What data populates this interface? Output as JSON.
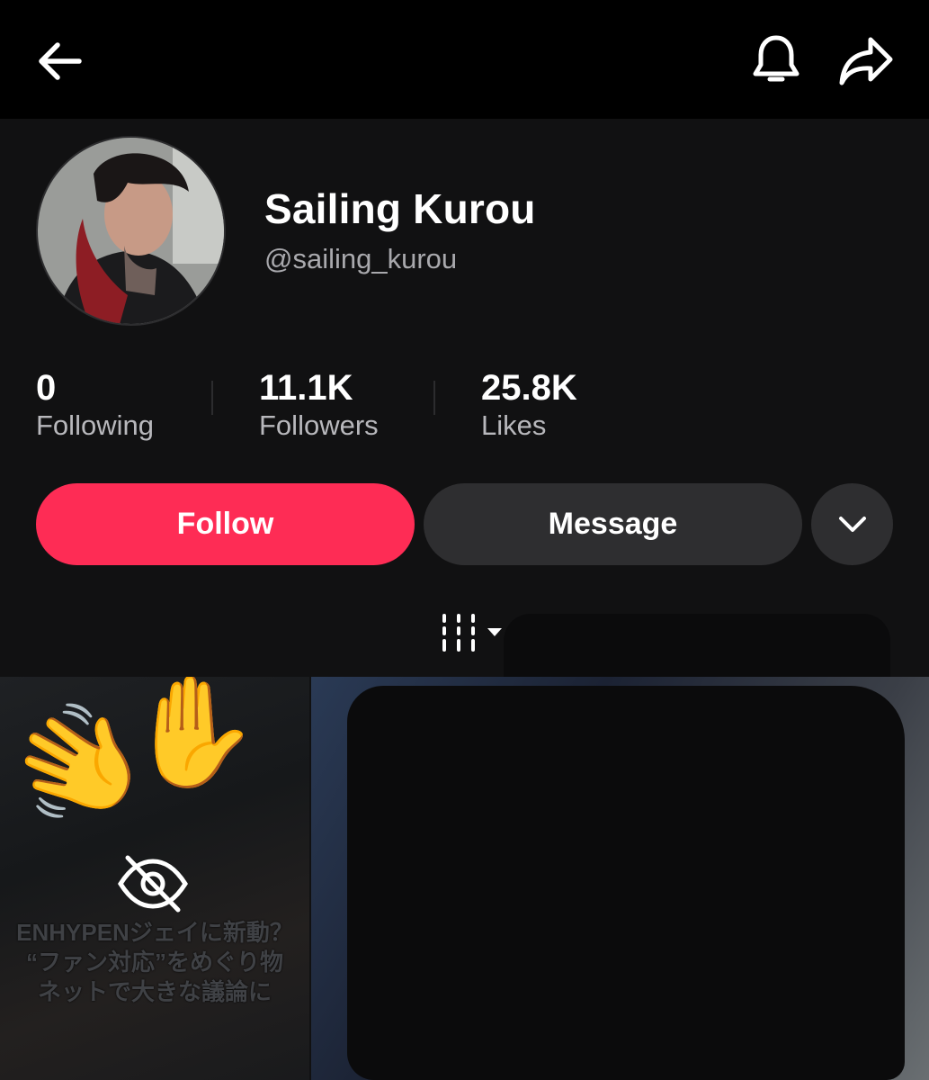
{
  "profile": {
    "display_name": "Sailing Kurou",
    "handle": "@sailing_kurou"
  },
  "stats": [
    {
      "value": "0",
      "label": "Following"
    },
    {
      "value": "11.1K",
      "label": "Followers"
    },
    {
      "value": "25.8K",
      "label": "Likes"
    }
  ],
  "actions": {
    "follow_label": "Follow",
    "message_label": "Message"
  },
  "icons": {
    "back": "arrow-left-icon",
    "notifications": "bell-icon",
    "share": "share-arrow-icon",
    "more": "chevron-down-icon",
    "filter": "column-filter-icon",
    "hidden": "eye-off-icon"
  },
  "colors": {
    "accent": "#fe2c55",
    "background": "#111112",
    "topbar": "#000000",
    "secondary_button": "#2e2e30",
    "muted_text": "#a9a9ad"
  },
  "videos": [
    {
      "caption_lines": [
        "ENHYPENジェイに新動？",
        "“ファン対応”をめぐり物",
        "ネットで大きな議論に"
      ],
      "hidden": true
    },
    {
      "caption_lines": [],
      "hidden": false
    }
  ]
}
